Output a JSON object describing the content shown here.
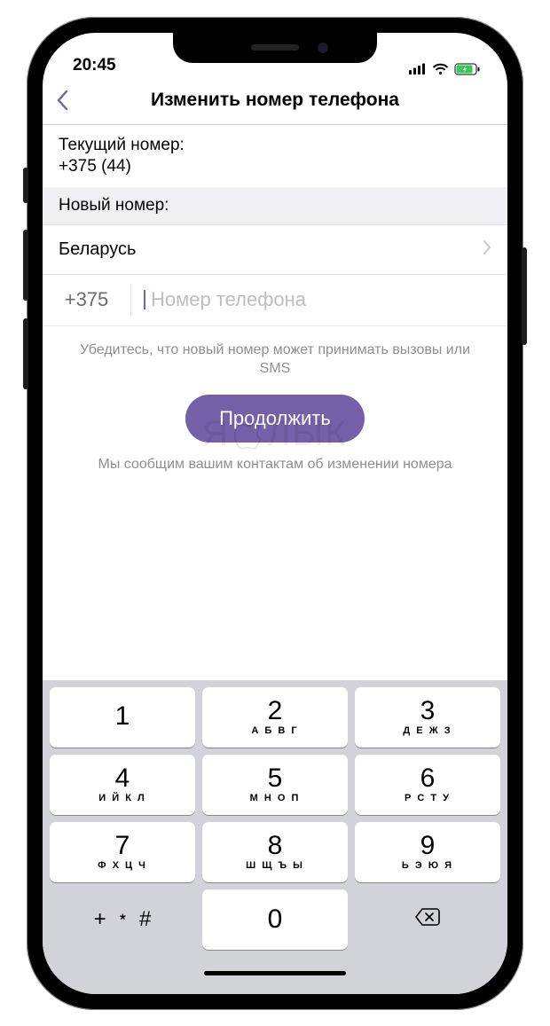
{
  "status": {
    "time": "20:45"
  },
  "nav": {
    "title": "Изменить номер телефона"
  },
  "current": {
    "label": "Текущий номер:",
    "value": "+375 (44)"
  },
  "newSection": {
    "header": "Новый номер:"
  },
  "country": {
    "name": "Беларусь"
  },
  "phone": {
    "code": "+375",
    "placeholder": "Номер телефона"
  },
  "hint": "Убедитесь, что новый номер может принимать вызовы или SMS",
  "cta": "Продолжить",
  "note": "Мы сообщим вашим контактам об изменении номера",
  "watermark": {
    "left": "Я",
    "right": "ЛЫК"
  },
  "keypad": {
    "symbols": "+ ﹡ #",
    "keys": [
      {
        "n": "1",
        "l": ""
      },
      {
        "n": "2",
        "l": "А Б В Г"
      },
      {
        "n": "3",
        "l": "Д Е Ж З"
      },
      {
        "n": "4",
        "l": "И Й К Л"
      },
      {
        "n": "5",
        "l": "М Н О П"
      },
      {
        "n": "6",
        "l": "Р С Т У"
      },
      {
        "n": "7",
        "l": "Ф Х Ц Ч"
      },
      {
        "n": "8",
        "l": "Ш Щ Ъ Ы"
      },
      {
        "n": "9",
        "l": "Ь Э Ю Я"
      },
      {
        "n": "0",
        "l": ""
      }
    ]
  }
}
